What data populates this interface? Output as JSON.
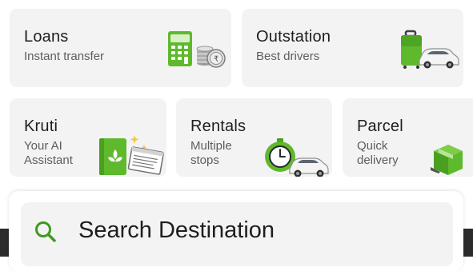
{
  "cards": {
    "loans": {
      "title": "Loans",
      "subtitle": "Instant transfer",
      "icon": "calculator-coins-icon"
    },
    "outstation": {
      "title": "Outstation",
      "subtitle": "Best drivers",
      "icon": "luggage-car-icon"
    },
    "kruti": {
      "title": "Kruti",
      "subtitle": "Your AI Assistant",
      "icon": "ai-notebook-icon"
    },
    "rentals": {
      "title": "Rentals",
      "subtitle": "Multiple stops",
      "icon": "stopwatch-car-icon"
    },
    "parcel": {
      "title": "Parcel",
      "subtitle": "Quick delivery",
      "icon": "parcel-box-icon"
    }
  },
  "search": {
    "label": "Search Destination",
    "icon": "search-icon"
  },
  "colors": {
    "accent_green": "#5fb92c",
    "card_bg": "#f3f3f3",
    "dark_band": "#2c2c2c"
  }
}
